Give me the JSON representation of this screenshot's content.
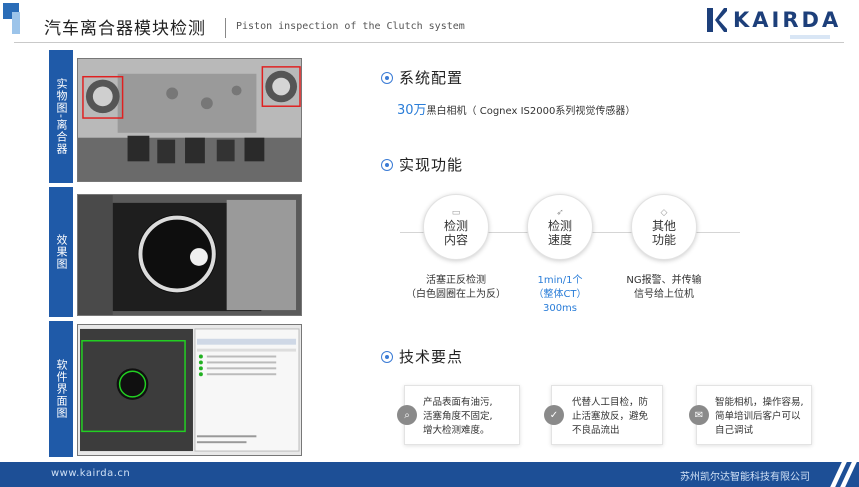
{
  "header": {
    "title": "汽车离合器模块检测",
    "subtitle": "Piston inspection of the Clutch system",
    "logo_text": "KAIRDA"
  },
  "left_panels": [
    {
      "label": "实物图-离合器"
    },
    {
      "label": "效果图"
    },
    {
      "label": "软件界面图"
    }
  ],
  "config": {
    "title": "系统配置",
    "highlight": "30万",
    "text": "黑白相机（ Cognex IS2000系列视觉传感器）"
  },
  "functions": {
    "title": "实现功能",
    "items": [
      {
        "label": [
          "检测",
          "内容"
        ],
        "icon": "monitor-icon",
        "desc": [
          "活塞正反检测",
          "（白色圆圈在上为反）"
        ]
      },
      {
        "label": [
          "检测",
          "速度"
        ],
        "icon": "rocket-icon",
        "desc": [
          "1min/1个",
          "（整体CT）",
          "300ms"
        ]
      },
      {
        "label": [
          "其他",
          "功能"
        ],
        "icon": "tag-icon",
        "desc": [
          "NG报警、并传输",
          "信号给上位机"
        ]
      }
    ]
  },
  "tech": {
    "title": "技术要点",
    "cards": [
      {
        "icon": "search-icon",
        "lines": [
          "产品表面有油污,",
          "活塞角度不固定,",
          "增大检测难度。"
        ]
      },
      {
        "icon": "check-icon",
        "lines": [
          "代替人工目检，防",
          "止活塞放反，避免",
          "不良品流出"
        ]
      },
      {
        "icon": "chat-icon",
        "lines": [
          "智能相机，操作容易,",
          "简单培训后客户可以",
          "自己调试"
        ]
      }
    ]
  },
  "footer": {
    "url": "www.kairda.cn",
    "company": "苏州凯尔达智能科技有限公司"
  },
  "colors": {
    "primary": "#1f5aa8",
    "accent": "#2a7dd8",
    "footer": "#1d4f96"
  }
}
